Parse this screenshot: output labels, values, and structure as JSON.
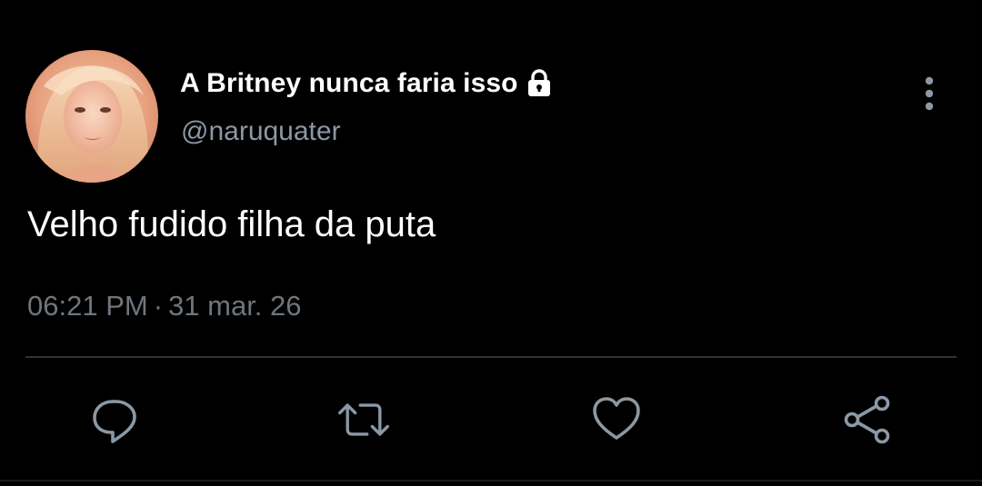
{
  "tweet": {
    "author": {
      "display_name": "A Britney nunca faria isso",
      "handle": "@naruquater",
      "protected_icon": "lock-icon",
      "avatar": "profile-photo"
    },
    "text": "Velho fudido filha da puta",
    "time": "06:21 PM",
    "separator": "·",
    "date": "31 mar. 26",
    "menu_icon": "more-vertical-icon"
  },
  "actions": [
    {
      "name": "reply",
      "icon": "reply-icon"
    },
    {
      "name": "retweet",
      "icon": "retweet-icon"
    },
    {
      "name": "like",
      "icon": "heart-icon"
    },
    {
      "name": "share",
      "icon": "share-icon"
    }
  ],
  "colors": {
    "background": "#000000",
    "primary_text": "#ffffff",
    "secondary_text": "#8b98a5",
    "meta_text": "#6e767d",
    "icon": "#8b98a5",
    "divider": "#2f3336"
  }
}
